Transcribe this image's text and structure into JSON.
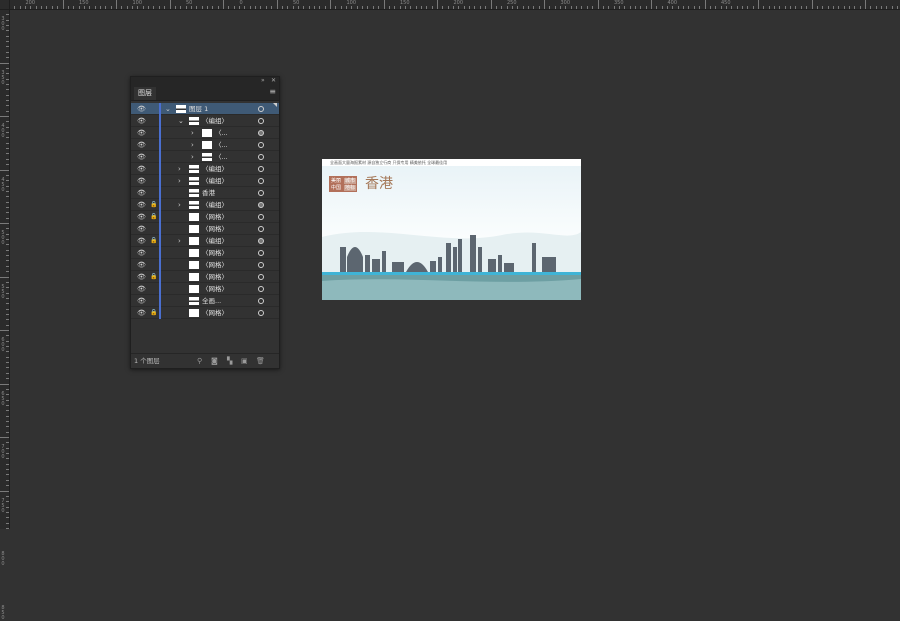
{
  "ruler": {
    "top_labels": [
      "250",
      "200",
      "150",
      "100",
      "50",
      "0",
      "50",
      "100",
      "150",
      "200",
      "250",
      "300",
      "350",
      "400",
      "450"
    ],
    "left_labels": [
      "300",
      "350",
      "400",
      "450",
      "500",
      "550",
      "600",
      "650",
      "700",
      "750",
      "800",
      "850"
    ]
  },
  "layers_panel": {
    "title": "图层",
    "collapse_icon": "double-chevron-icon",
    "close_icon": "close-icon",
    "menu_icon": "menu-icon",
    "rows": [
      {
        "label": "图层 1"
      },
      {
        "label": "〈编组〉"
      },
      {
        "label": "〈..."
      },
      {
        "label": "〈..."
      },
      {
        "label": "〈..."
      },
      {
        "label": "〈编组〉"
      },
      {
        "label": "〈编组〉"
      },
      {
        "label": "香港"
      },
      {
        "label": "〈编组〉"
      },
      {
        "label": "〈网格〉"
      },
      {
        "label": "〈网格〉"
      },
      {
        "label": "〈编组〉"
      },
      {
        "label": "〈网格〉"
      },
      {
        "label": "〈网格〉"
      },
      {
        "label": "〈网格〉"
      },
      {
        "label": "〈网格〉"
      },
      {
        "label": "全画..."
      },
      {
        "label": "〈网格〉"
      }
    ],
    "footer": {
      "count": "1 个图层"
    },
    "colors": {
      "accent_bar": "#4a6fd0",
      "selected_row": "#3f5a76"
    }
  },
  "artwork": {
    "header_text": "全画面大量海报素材  源自独立行商  只保专用  精美依托  全球最佳用",
    "badge": {
      "line1_left": "美丽",
      "line1_right": "城市",
      "line2_left": "中国",
      "line2_right": "地标"
    },
    "city_name": "香港",
    "colors": {
      "title": "#a57858",
      "badge": "#b2705a",
      "water": "#5f9aa0"
    }
  }
}
